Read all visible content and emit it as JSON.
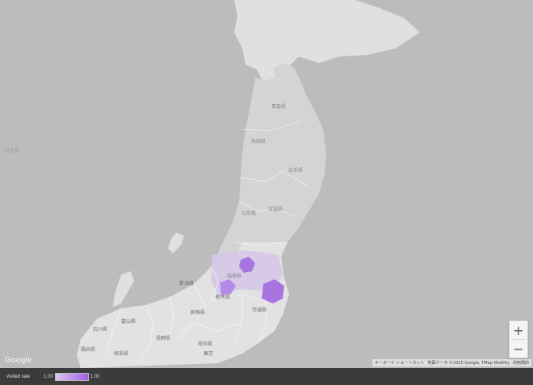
{
  "map": {
    "sea_label": "日本海",
    "prefectures": [
      {
        "name": "青森県",
        "kind": "prefecture"
      },
      {
        "name": "秋田県",
        "kind": "prefecture"
      },
      {
        "name": "岩手県",
        "kind": "prefecture"
      },
      {
        "name": "山形県",
        "kind": "prefecture"
      },
      {
        "name": "宮城県",
        "kind": "prefecture"
      },
      {
        "name": "福島県",
        "kind": "prefecture"
      },
      {
        "name": "新潟県",
        "kind": "prefecture"
      },
      {
        "name": "栃木県",
        "kind": "prefecture"
      },
      {
        "name": "群馬県",
        "kind": "prefecture"
      },
      {
        "name": "茨城県",
        "kind": "prefecture"
      },
      {
        "name": "富山県",
        "kind": "prefecture"
      },
      {
        "name": "石川県",
        "kind": "prefecture"
      },
      {
        "name": "長野県",
        "kind": "prefecture"
      },
      {
        "name": "埼玉県",
        "kind": "prefecture"
      },
      {
        "name": "福井県",
        "kind": "prefecture"
      },
      {
        "name": "岐阜県",
        "kind": "prefecture"
      },
      {
        "name": "東京",
        "kind": "prefecture"
      }
    ]
  },
  "controls": {
    "zoom_in": "+",
    "zoom_out": "−"
  },
  "google_logo": "Google",
  "attribution": {
    "shortcuts": "キーボード ショートカット",
    "map_data": "地図データ ©2025 Google, TMap Mobility",
    "terms": "利用規約"
  },
  "legend": {
    "title": "visited rate",
    "min": "1.00",
    "max": "1.00",
    "color_low": "#d9c7ee",
    "color_high": "#a060e6"
  },
  "colors": {
    "land": "#e0e0e0",
    "land_tohoku": "#d2d2d2",
    "water": "#bcbcbc",
    "highlight_light": "#d4c6e6",
    "highlight_dark": "#a875e0"
  }
}
